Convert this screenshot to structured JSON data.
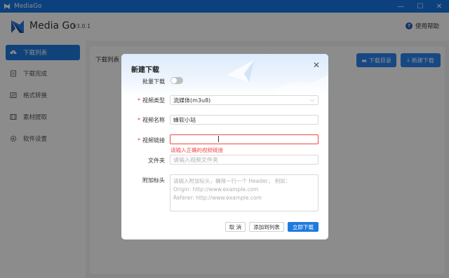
{
  "window": {
    "title": "MediaGo",
    "minimize": "—",
    "maximize": "☐",
    "close": "✕"
  },
  "header": {
    "app_name": "Media Go",
    "version": "v3.0.1",
    "help": "使用帮助"
  },
  "sidebar": {
    "items": [
      {
        "label": "下载列表",
        "icon": "download-cloud-icon",
        "active": true
      },
      {
        "label": "下载完成",
        "icon": "file-icon",
        "active": false
      },
      {
        "label": "格式转换",
        "icon": "convert-icon",
        "active": false
      },
      {
        "label": "素材提取",
        "icon": "film-icon",
        "active": false
      },
      {
        "label": "软件设置",
        "icon": "gear-icon",
        "active": false
      }
    ]
  },
  "main": {
    "title": "下载列表",
    "dir_button": "下载目录",
    "new_button": "新建下载"
  },
  "modal": {
    "title": "新建下载",
    "batch_label": "批量下载",
    "batch_on": false,
    "type_label": "视频类型",
    "type_value": "流媒体(m3u8)",
    "name_label": "视频名称",
    "name_value": "蜂软小站",
    "url_label": "视频链接",
    "url_value": "",
    "url_error": "请输入正确的视频链接",
    "folder_label": "文件夹",
    "folder_placeholder": "请输入视频文件夹",
    "headers_label": "附加标头",
    "headers_placeholder": [
      "请输入附加标头，确保一行一个 Header， 例如：",
      "Origin: http://www.example.com",
      "Referer: http://www.example.com"
    ],
    "cancel": "取 消",
    "add_to_list": "添加到列表",
    "download_now": "立即下载"
  },
  "colors": {
    "accent": "#1f7ae0",
    "titlebar": "#1677e6",
    "error": "#f04a4a"
  }
}
